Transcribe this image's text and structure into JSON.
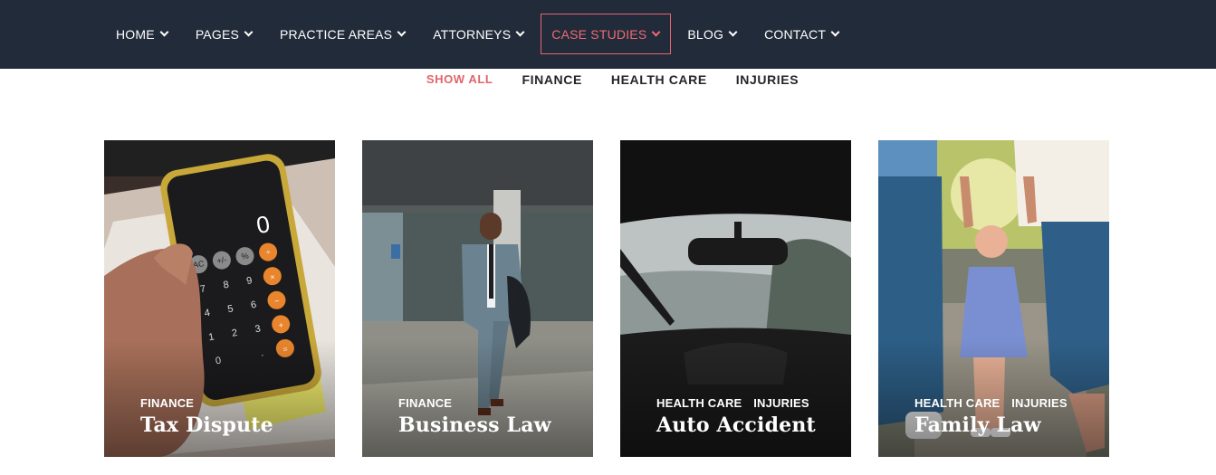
{
  "nav": {
    "items": [
      {
        "label": "HOME"
      },
      {
        "label": "PAGES"
      },
      {
        "label": "PRACTICE AREAS"
      },
      {
        "label": "ATTORNEYS"
      },
      {
        "label": "CASE STUDIES",
        "active": true
      },
      {
        "label": "BLOG"
      },
      {
        "label": "CONTACT"
      }
    ]
  },
  "filters": [
    {
      "label": "SHOW ALL",
      "active": true
    },
    {
      "label": "FINANCE"
    },
    {
      "label": "HEALTH CARE"
    },
    {
      "label": "INJURIES"
    }
  ],
  "cards": [
    {
      "categories": [
        "FINANCE"
      ],
      "title": "Tax Dispute"
    },
    {
      "categories": [
        "FINANCE"
      ],
      "title": "Business Law"
    },
    {
      "categories": [
        "HEALTH CARE",
        "INJURIES"
      ],
      "title": "Auto Accident"
    },
    {
      "categories": [
        "HEALTH CARE",
        "INJURIES"
      ],
      "title": "Family Law"
    }
  ],
  "colors": {
    "nav_bg": "#222b3a",
    "accent": "#e8646f",
    "text_dark": "#262626"
  },
  "calculator": {
    "display": "0",
    "keys": [
      "AC",
      "+/-",
      "%",
      "÷",
      "7",
      "8",
      "9",
      "×",
      "4",
      "5",
      "6",
      "−",
      "1",
      "2",
      "3",
      "+",
      "0",
      ".",
      "="
    ]
  }
}
